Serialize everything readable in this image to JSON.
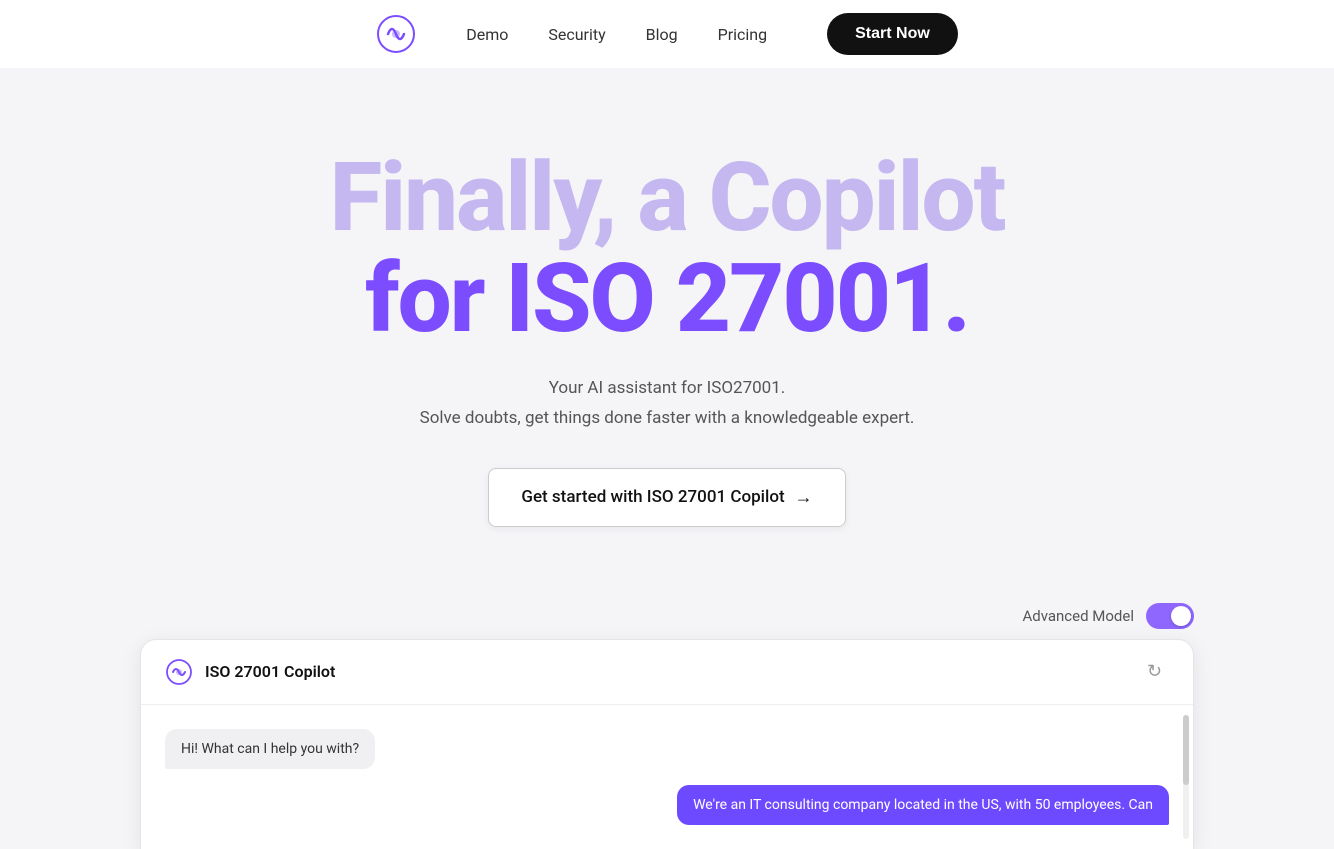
{
  "nav": {
    "demo_label": "Demo",
    "security_label": "Security",
    "blog_label": "Blog",
    "pricing_label": "Pricing",
    "cta_label": "Start Now"
  },
  "hero": {
    "title_line1": "Finally, a Copilot",
    "title_line2": "for ISO 27001.",
    "subtitle1": "Your AI assistant for ISO27001.",
    "subtitle2": "Solve doubts, get things done faster with a knowledgeable expert.",
    "cta_label": "Get started with ISO 27001 Copilot",
    "arrow": "→"
  },
  "chat": {
    "advanced_model_label": "Advanced Model",
    "chat_title": "ISO 27001 Copilot",
    "refresh_icon": "↻",
    "bot_message": "Hi! What can I help you with?",
    "user_message": "We're an IT consulting company located in the US, with 50 employees. Can"
  }
}
